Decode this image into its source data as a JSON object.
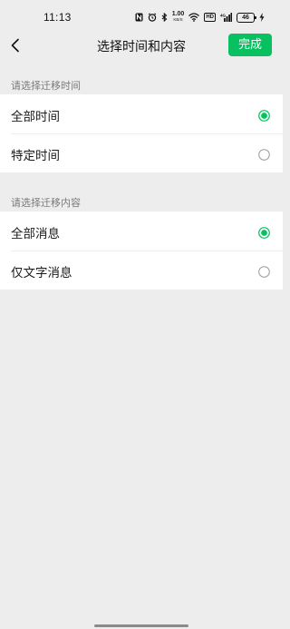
{
  "status_bar": {
    "time": "11:13",
    "net_speed_value": "1.00",
    "net_speed_unit": "KB/S",
    "hd_label": "HD",
    "signal_label": "4G",
    "battery_level": "46"
  },
  "nav": {
    "title": "选择时间和内容",
    "done_label": "完成"
  },
  "time_section": {
    "header": "请选择迁移时间",
    "options": [
      {
        "label": "全部时间",
        "selected": true
      },
      {
        "label": "特定时间",
        "selected": false
      }
    ]
  },
  "content_section": {
    "header": "请选择迁移内容",
    "options": [
      {
        "label": "全部消息",
        "selected": true
      },
      {
        "label": "仅文字消息",
        "selected": false
      }
    ]
  },
  "colors": {
    "accent": "#07c160",
    "background": "#ededed",
    "radio_unselected": "#9a9a9a"
  }
}
